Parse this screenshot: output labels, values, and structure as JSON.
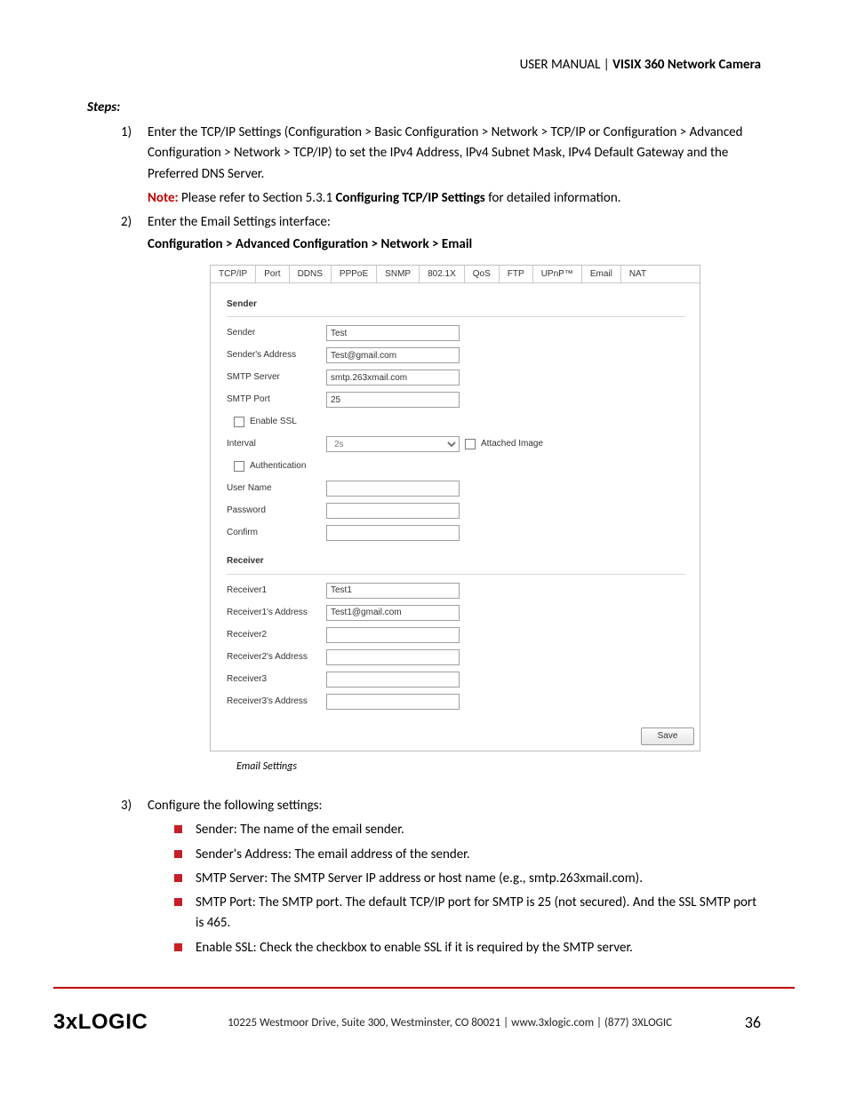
{
  "header": {
    "thin": "USER MANUAL | ",
    "bold": "VISIX 360 Network Camera"
  },
  "steps_label": "Steps:",
  "steps": {
    "s1": {
      "num": "1)",
      "p1": "Enter the TCP/IP Settings (Configuration > Basic Configuration > Network > TCP/IP or Configuration > Advanced Configuration > Network > TCP/IP) to set the IPv4 Address, IPv4 Subnet Mask, IPv4 Default Gateway and the Preferred DNS Server.",
      "note_label": "Note:",
      "note_rest": " Please refer to Section 5.3.1 ",
      "note_bold": "Configuring TCP/IP Settings",
      "note_tail": " for detailed information."
    },
    "s2": {
      "num": "2)",
      "p1": "Enter the Email Settings interface:",
      "crumb": "Configuration > Advanced Configuration > Network > Email"
    },
    "s3": {
      "num": "3)",
      "p1": "Configure the following settings:"
    }
  },
  "tabs": [
    "TCP/IP",
    "Port",
    "DDNS",
    "PPPoE",
    "SNMP",
    "802.1X",
    "QoS",
    "FTP",
    "UPnP™",
    "Email",
    "NAT"
  ],
  "form": {
    "sender_h": "Sender",
    "sender_lab": "Sender",
    "sender_val": "Test",
    "senderaddr_lab": "Sender's Address",
    "senderaddr_val": "Test@gmail.com",
    "smtpserver_lab": "SMTP Server",
    "smtpserver_val": "smtp.263xmail.com",
    "smtpport_lab": "SMTP Port",
    "smtpport_val": "25",
    "ssl_lab": "Enable SSL",
    "interval_lab": "Interval",
    "interval_val": "2s",
    "attached_lab": "Attached Image",
    "auth_lab": "Authentication",
    "user_lab": "User Name",
    "user_val": "",
    "pass_lab": "Password",
    "pass_val": "",
    "confirm_lab": "Confirm",
    "confirm_val": "",
    "receiver_h": "Receiver",
    "r1_lab": "Receiver1",
    "r1_val": "Test1",
    "r1a_lab": "Receiver1's Address",
    "r1a_val": "Test1@gmail.com",
    "r2_lab": "Receiver2",
    "r2_val": "",
    "r2a_lab": "Receiver2's Address",
    "r2a_val": "",
    "r3_lab": "Receiver3",
    "r3_val": "",
    "r3a_lab": "Receiver3's Address",
    "r3a_val": "",
    "save": "Save"
  },
  "caption": "Email Settings",
  "bullets": {
    "b1": "Sender: The name of the email sender.",
    "b2": "Sender's Address: The email address of the sender.",
    "b3": "SMTP Server: The SMTP Server IP address or host name (e.g., smtp.263xmail.com).",
    "b4": "SMTP Port: The SMTP port. The default TCP/IP port for SMTP is 25 (not secured). And the SSL SMTP port is 465.",
    "b5": "Enable SSL: Check the checkbox to enable SSL if it is required by the SMTP server."
  },
  "footer": {
    "logo": "3xLOGIC",
    "addr": "10225 Westmoor Drive, Suite 300, Westminster, CO 80021 | www.3xlogic.com | (877) 3XLOGIC",
    "page": "36"
  }
}
